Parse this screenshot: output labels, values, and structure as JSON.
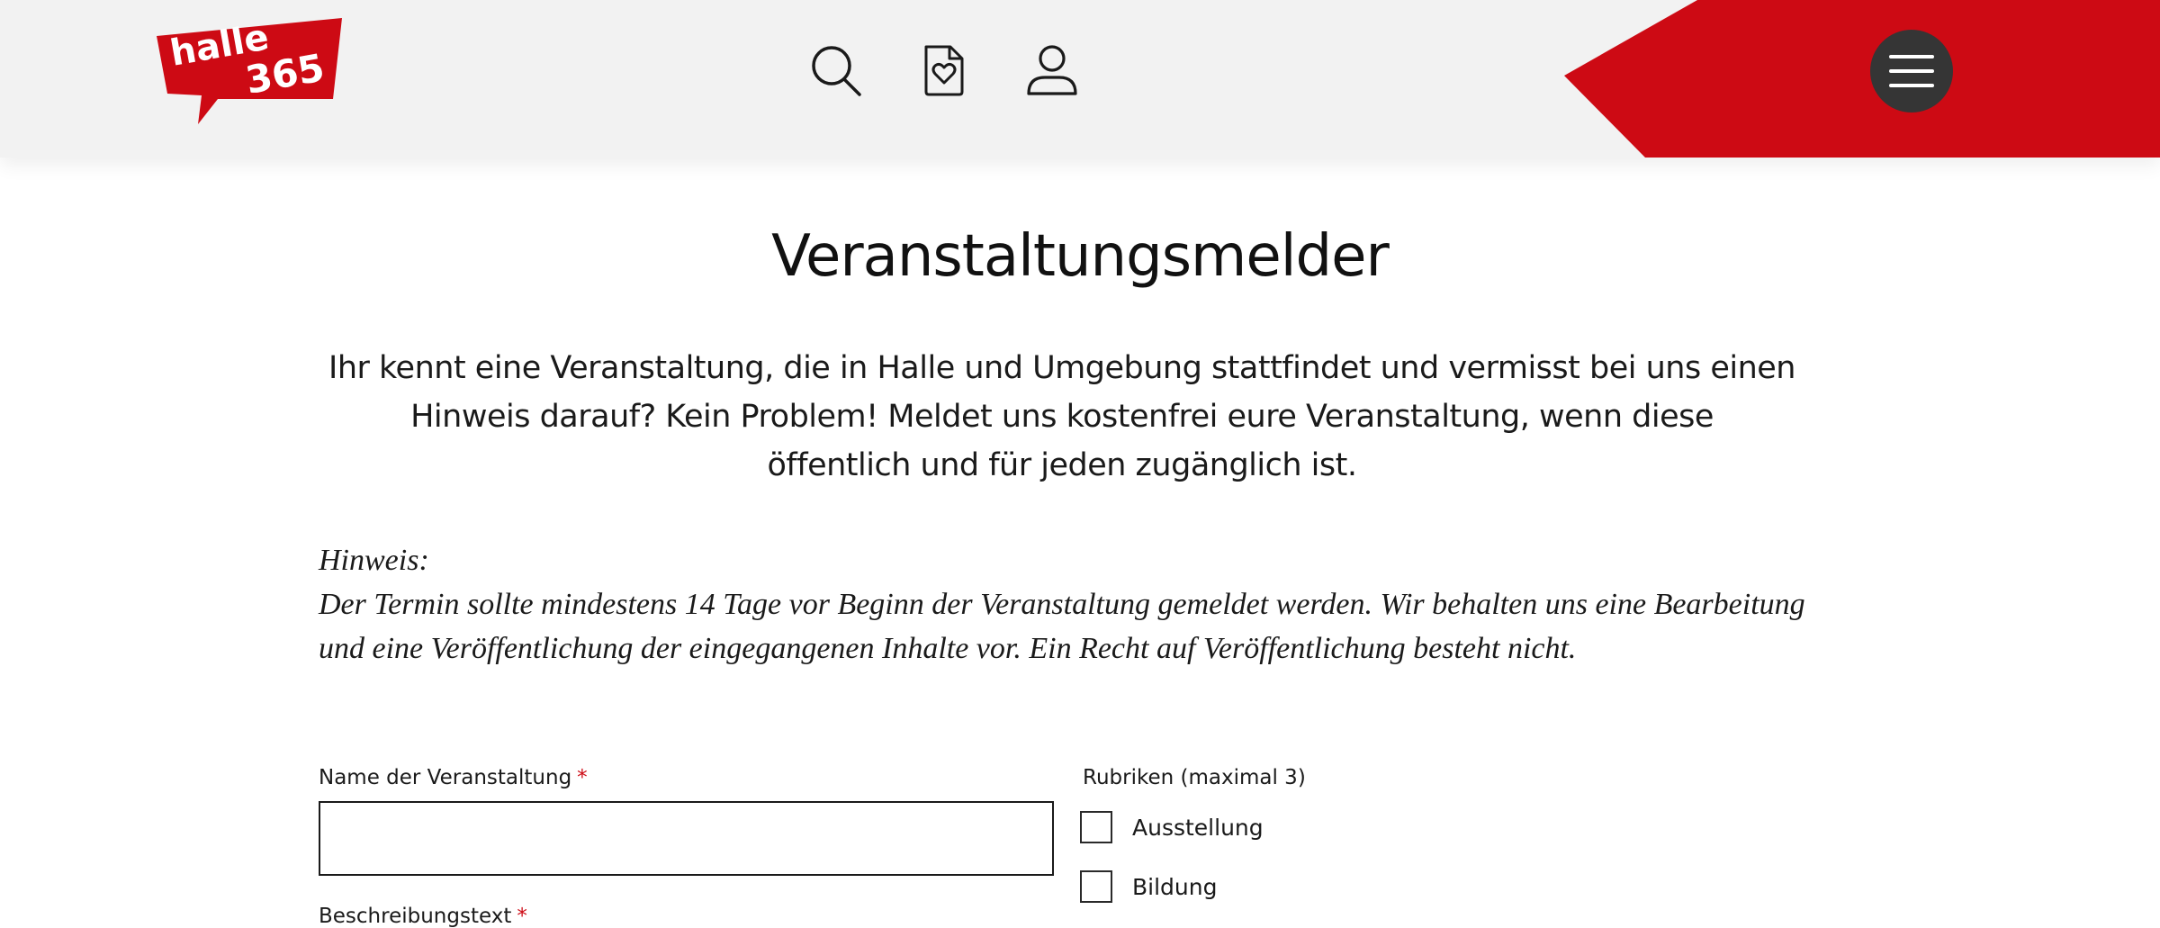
{
  "brand": {
    "logo_top": "halle",
    "logo_bottom": "365",
    "accent_color": "#cd0a14",
    "header_bg": "#f2f2f2",
    "menu_button_color": "#353535"
  },
  "header": {
    "icons": [
      "search-icon",
      "favorites-document-icon",
      "user-icon",
      "hamburger-menu-icon"
    ]
  },
  "main": {
    "title": "Veranstaltungsmelder",
    "intro_lines": [
      "Ihr kennt eine Veranstaltung, die in Halle und Umgebung stattfindet und vermisst bei uns einen",
      "Hinweis darauf? Kein Problem! Meldet uns kostenfrei eure Veranstaltung, wenn diese",
      "öffentlich und für jeden zugänglich ist."
    ],
    "hint_lines": [
      "Hinweis:",
      "Der Termin sollte mindestens 14 Tage vor Beginn der Veranstaltung gemeldet werden. Wir  behalten uns eine Bearbeitung",
      "und eine Veröffentlichung der eingegangenen Inhalte vor. Ein Recht auf Veröffentlichung besteht nicht."
    ]
  },
  "form": {
    "event_name": {
      "label": "Name der Veranstaltung",
      "required_mark": "*",
      "value": ""
    },
    "description": {
      "label": "Beschreibungstext",
      "required_mark": "*"
    },
    "categories": {
      "label": "Rubriken (maximal 3)",
      "options": [
        {
          "label": "Ausstellung",
          "checked": false
        },
        {
          "label": "Bildung",
          "checked": false
        }
      ]
    }
  }
}
